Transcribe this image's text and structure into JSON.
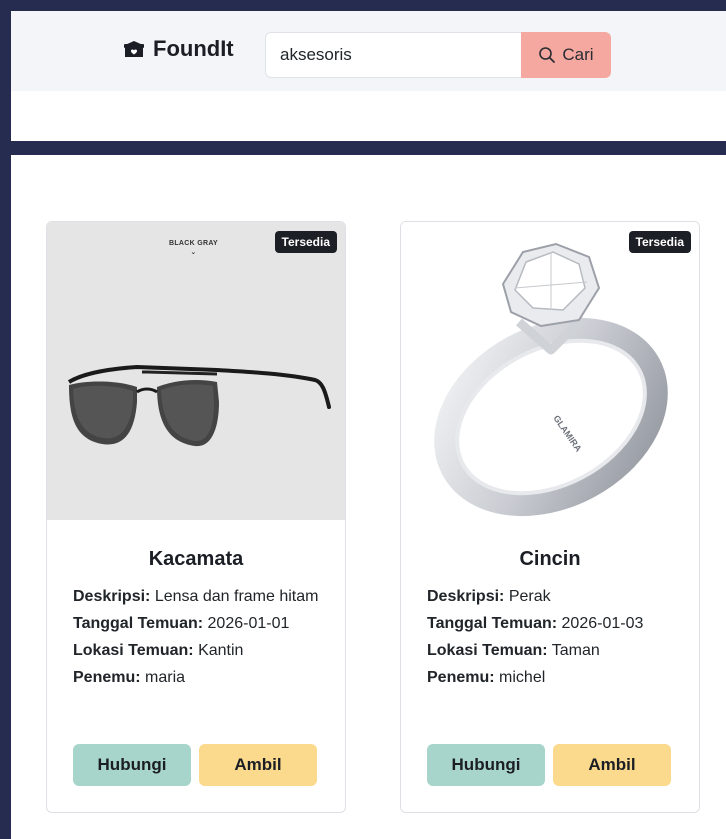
{
  "navbar": {
    "brand": "FoundIt",
    "search": {
      "value": "aksesoris",
      "button_label": "Cari"
    }
  },
  "items": [
    {
      "title": "Kacamata",
      "status": "Tersedia",
      "image_caption": "BLACK GRAY",
      "fields": [
        {
          "label": "Deskripsi:",
          "value": "Lensa dan frame hitam"
        },
        {
          "label": "Tanggal Temuan:",
          "value": "2026-01-01"
        },
        {
          "label": "Lokasi Temuan:",
          "value": "Kantin"
        },
        {
          "label": "Penemu:",
          "value": "maria"
        }
      ],
      "buttons": {
        "contact": "Hubungi",
        "take": "Ambil"
      }
    },
    {
      "title": "Cincin",
      "status": "Tersedia",
      "image_engraving": "GLAMIRA",
      "fields": [
        {
          "label": "Deskripsi:",
          "value": "Perak"
        },
        {
          "label": "Tanggal Temuan:",
          "value": "2026-01-03"
        },
        {
          "label": "Lokasi Temuan:",
          "value": "Taman"
        },
        {
          "label": "Penemu:",
          "value": "michel"
        }
      ],
      "buttons": {
        "contact": "Hubungi",
        "take": "Ambil"
      }
    }
  ],
  "icons": {
    "brand": "box-heart-icon",
    "search": "search-icon"
  },
  "colors": {
    "nav_bg": "#f4f5f8",
    "search_button": "#f4a89f",
    "contact_button": "#a8d5cb",
    "take_button": "#fbd98d",
    "badge": "#1c1f25"
  }
}
